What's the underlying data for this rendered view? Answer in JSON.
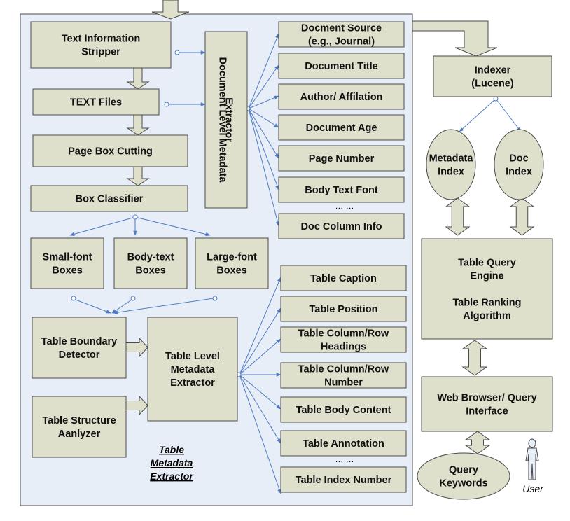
{
  "colors": {
    "box_fill": "#dfe0cc",
    "container_fill": "#e8eef7",
    "connector": "#4f7cc4",
    "border": "#4a4a4a"
  },
  "nodes": {
    "stripper": {
      "lines": [
        "Text Information",
        "Stripper"
      ]
    },
    "text_files": {
      "lines": [
        "TEXT Files"
      ]
    },
    "page_box": {
      "lines": [
        "Page Box Cutting"
      ]
    },
    "classifier": {
      "lines": [
        "Box Classifier"
      ]
    },
    "small_font": {
      "lines": [
        "Small-font",
        "Boxes"
      ]
    },
    "body_text": {
      "lines": [
        "Body-text",
        "Boxes"
      ]
    },
    "large_font": {
      "lines": [
        "Large-font",
        "Boxes"
      ]
    },
    "boundary": {
      "lines": [
        "Table Boundary",
        "Detector"
      ]
    },
    "structure": {
      "lines": [
        "Table Structure",
        "Aanlyzer"
      ]
    },
    "table_extractor": {
      "lines": [
        "Table Level",
        "Metadata",
        "Extractor"
      ]
    },
    "doc_extractor": {
      "lines": [
        "Document Level Metadata",
        "Extractor"
      ]
    },
    "doc_source": {
      "lines": [
        "Docment Source",
        "(e.g., Journal)"
      ]
    },
    "doc_title": {
      "lines": [
        "Document Title"
      ]
    },
    "author": {
      "lines": [
        "Author/ Affilation"
      ]
    },
    "doc_age": {
      "lines": [
        "Document Age"
      ]
    },
    "page_number": {
      "lines": [
        "Page Number"
      ]
    },
    "body_font": {
      "lines": [
        "Body Text Font"
      ]
    },
    "doc_column": {
      "lines": [
        "Doc Column Info"
      ]
    },
    "t_caption": {
      "lines": [
        "Table Caption"
      ]
    },
    "t_position": {
      "lines": [
        "Table Position"
      ]
    },
    "t_headings": {
      "lines": [
        "Table Column/Row",
        "Headings"
      ]
    },
    "t_number": {
      "lines": [
        "Table Column/Row",
        "Number"
      ]
    },
    "t_body": {
      "lines": [
        "Table Body Content"
      ]
    },
    "t_annotation": {
      "lines": [
        "Table Annotation"
      ]
    },
    "t_index": {
      "lines": [
        "Table Index Number"
      ]
    },
    "indexer": {
      "lines": [
        "Indexer",
        "(Lucene)"
      ]
    },
    "meta_index": {
      "lines": [
        "Metadata",
        "Index"
      ]
    },
    "doc_index": {
      "lines": [
        "Doc",
        "Index"
      ]
    },
    "engine": {
      "lines": [
        "Table Query",
        "Engine",
        "",
        "Table Ranking",
        "Algorithm"
      ]
    },
    "browser": {
      "lines": [
        "Web Browser/ Query",
        "Interface"
      ]
    },
    "keywords": {
      "lines": [
        "Query",
        "Keywords"
      ]
    }
  },
  "ellipsis_doc": "… …",
  "ellipsis_table": "… …",
  "container_label": [
    "Table",
    "Metadata",
    "Extractor"
  ],
  "user_label": "User",
  "user_icon": "person-icon"
}
